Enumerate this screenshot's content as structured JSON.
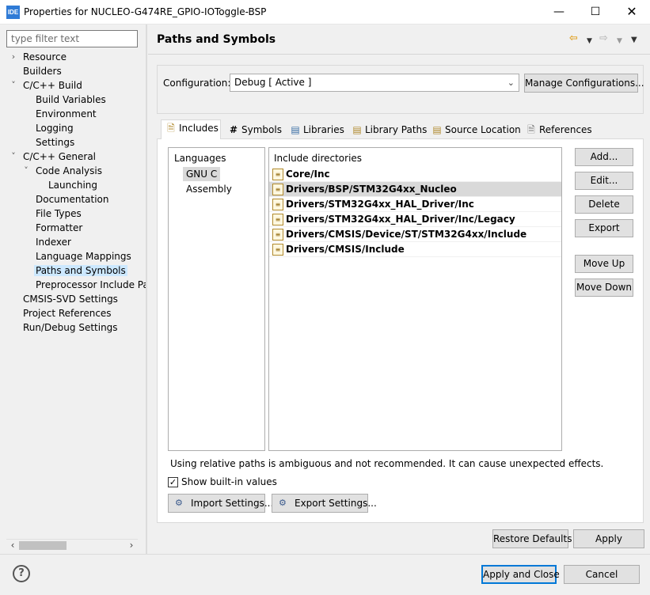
{
  "window": {
    "app_icon": "IDE",
    "title": "Properties for NUCLEO-G474RE_GPIO-IOToggle-BSP",
    "controls": [
      "minimize-icon",
      "maximize-icon",
      "close-icon"
    ]
  },
  "sidebar": {
    "filter_placeholder": "type filter text",
    "items": [
      {
        "label": "Resource",
        "expander": "closed"
      },
      {
        "label": "Builders"
      },
      {
        "label": "C/C++ Build",
        "expander": "open"
      },
      {
        "label": "Build Variables"
      },
      {
        "label": "Environment"
      },
      {
        "label": "Logging"
      },
      {
        "label": "Settings"
      },
      {
        "label": "C/C++ General",
        "expander": "open"
      },
      {
        "label": "Code Analysis",
        "expander": "open"
      },
      {
        "label": "Launching"
      },
      {
        "label": "Documentation"
      },
      {
        "label": "File Types"
      },
      {
        "label": "Formatter"
      },
      {
        "label": "Indexer"
      },
      {
        "label": "Language Mappings"
      },
      {
        "label": "Paths and Symbols",
        "selected": true
      },
      {
        "label": "Preprocessor Include Pat"
      },
      {
        "label": "CMSIS-SVD Settings"
      },
      {
        "label": "Project References"
      },
      {
        "label": "Run/Debug Settings"
      }
    ]
  },
  "page": {
    "title": "Paths and Symbols",
    "nav_icons": [
      "back-icon",
      "back-menu-icon",
      "forward-icon",
      "forward-menu-icon",
      "view-menu-icon"
    ]
  },
  "configuration": {
    "label": "Configuration:",
    "value": "Debug  [ Active ]",
    "manage_button": "Manage Configurations..."
  },
  "tabs": [
    {
      "label": "Includes",
      "icon": "includes-icon",
      "active": true
    },
    {
      "label": "Symbols",
      "icon": "hash-icon"
    },
    {
      "label": "Libraries",
      "icon": "libraries-icon"
    },
    {
      "label": "Library Paths",
      "icon": "library-paths-icon"
    },
    {
      "label": "Source Location",
      "icon": "source-location-icon"
    },
    {
      "label": "References",
      "icon": "references-icon"
    }
  ],
  "languages": {
    "header": "Languages",
    "items": [
      {
        "label": "GNU C",
        "selected": true
      },
      {
        "label": "Assembly"
      }
    ]
  },
  "include_dirs": {
    "header": "Include directories",
    "items": [
      {
        "path": "Core/Inc"
      },
      {
        "path": "Drivers/BSP/STM32G4xx_Nucleo",
        "selected": true
      },
      {
        "path": "Drivers/STM32G4xx_HAL_Driver/Inc"
      },
      {
        "path": "Drivers/STM32G4xx_HAL_Driver/Inc/Legacy"
      },
      {
        "path": "Drivers/CMSIS/Device/ST/STM32G4xx/Include"
      },
      {
        "path": "Drivers/CMSIS/Include"
      }
    ]
  },
  "side_buttons": {
    "add": "Add...",
    "edit": "Edit...",
    "delete": "Delete",
    "export": "Export",
    "move_up": "Move Up",
    "move_down": "Move Down"
  },
  "warning": "Using relative paths is ambiguous and not recommended. It can cause unexpected effects.",
  "show_builtin": {
    "label": "Show built-in values",
    "checked": true
  },
  "import_settings": "Import Settings...",
  "export_settings": "Export Settings...",
  "restore_defaults": "Restore Defaults",
  "apply": "Apply",
  "apply_and_close": "Apply and Close",
  "cancel": "Cancel",
  "colors": {
    "selection": "#cce8ff",
    "focus_border": "#0078d7",
    "back_arrow": "#e0a125"
  }
}
